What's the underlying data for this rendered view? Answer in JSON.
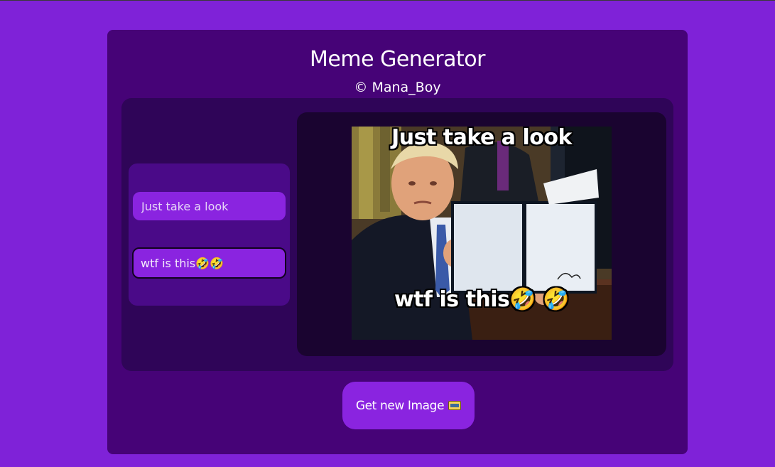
{
  "header": {
    "title": "Meme Generator",
    "credit": "© Mana_Boy"
  },
  "form": {
    "top_text": {
      "value": "",
      "placeholder": "Just take a look"
    },
    "bottom_text": {
      "value": "wtf is this🤣🤣",
      "placeholder": ""
    }
  },
  "meme": {
    "top_caption": "Just take a look",
    "bottom_caption": "wtf is this🤣 🤣"
  },
  "actions": {
    "get_image_label": "Get new Image",
    "get_image_icon": "framed-picture-icon"
  },
  "colors": {
    "page_background": "#7f22d8",
    "card_background": "#460377",
    "accent": "#8a24e0"
  }
}
